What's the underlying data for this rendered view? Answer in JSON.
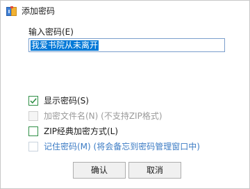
{
  "window": {
    "title": "添加密码"
  },
  "password": {
    "label": "输入密码(E)",
    "value": "我爱书院从未离开"
  },
  "options": {
    "show_password": {
      "label": "显示密码(S)",
      "checked": true,
      "enabled": true
    },
    "encrypt_filename": {
      "label": "加密文件名(N) (不支持ZIP格式)",
      "checked": false,
      "enabled": false
    },
    "zip_classic": {
      "label": "ZIP经典加密方式(L)",
      "checked": false,
      "enabled": true
    },
    "remember_password": {
      "label": "记住密码(M) (将会备忘到密码管理窗口中)",
      "checked": false,
      "enabled": true
    }
  },
  "buttons": {
    "ok": "确认",
    "cancel": "取消"
  },
  "colors": {
    "accent": "#0078d7",
    "check": "#2f8f46",
    "link_text": "#3b7bc4",
    "disabled_text": "#9a9a9a"
  },
  "icons": {
    "app": "archive-lock-icon",
    "check": "check-icon"
  }
}
